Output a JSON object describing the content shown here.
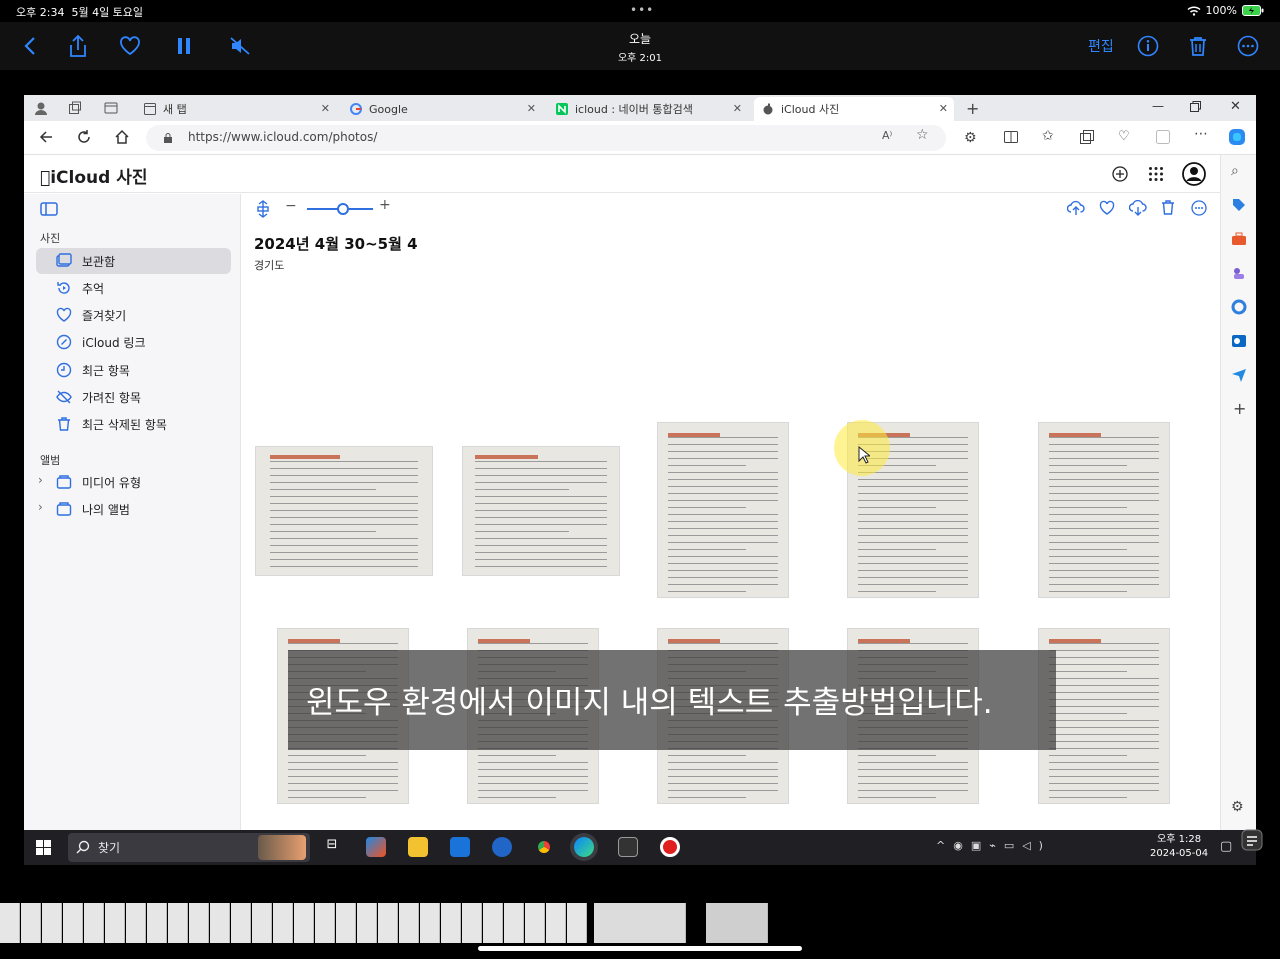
{
  "ios": {
    "time": "오후 2:34",
    "date": "5월 4일 토요일",
    "battery": "100%",
    "title": "오늘",
    "subtitle": "오후 2:01",
    "edit_label": "편집"
  },
  "browser": {
    "tabs": [
      {
        "label": "새 탭"
      },
      {
        "label": "Google"
      },
      {
        "label": "icloud : 네이버 통합검색"
      },
      {
        "label": "iCloud 사진"
      }
    ],
    "url": "https://www.icloud.com/photos/"
  },
  "app": {
    "brand": "iCloud 사진",
    "title": "2024년 4월 30~5월 4",
    "location": "경기도",
    "zoom_level": 0.55
  },
  "sidebar": {
    "photos_section": "사진",
    "items": [
      {
        "label": "보관함",
        "icon": "library-icon"
      },
      {
        "label": "추억",
        "icon": "memories-icon"
      },
      {
        "label": "즐겨찾기",
        "icon": "heart-icon"
      },
      {
        "label": "iCloud 링크",
        "icon": "link-icon"
      },
      {
        "label": "최근 항목",
        "icon": "clock-icon"
      },
      {
        "label": "가려진 항목",
        "icon": "eye-slash-icon"
      },
      {
        "label": "최근 삭제된 항목",
        "icon": "trash-icon"
      }
    ],
    "albums_section": "앨범",
    "albums": [
      {
        "label": "미디어 유형",
        "icon": "folder-icon"
      },
      {
        "label": "나의 앨범",
        "icon": "folder-icon"
      }
    ]
  },
  "taskbar": {
    "search_label": "찾기",
    "time": "오후 1:28",
    "date": "2024-05-04"
  },
  "caption": "윈도우 환경에서 이미지 내의 텍스트 추출방법입니다."
}
